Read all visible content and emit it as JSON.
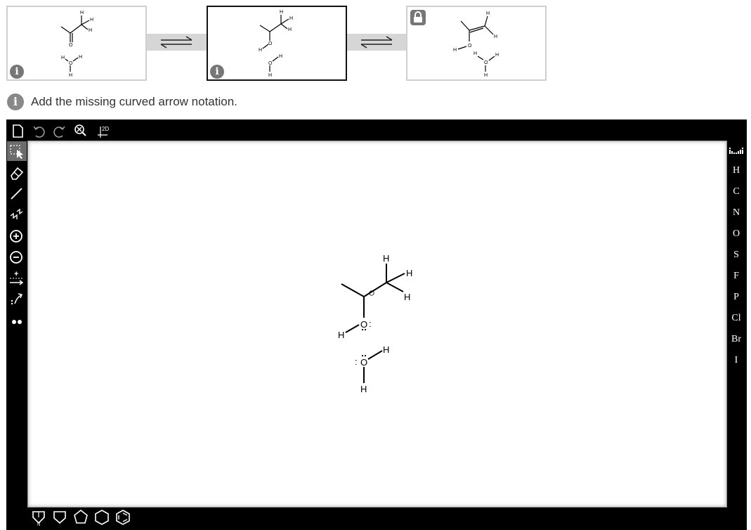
{
  "instruction": {
    "text": "Add the missing curved arrow notation.",
    "icon": "info-icon"
  },
  "steps": [
    {
      "name": "step-1",
      "icon": "info-icon",
      "state": "normal"
    },
    {
      "name": "step-2",
      "icon": "info-icon",
      "state": "current"
    },
    {
      "name": "step-3",
      "icon": "lock-icon",
      "state": "locked"
    }
  ],
  "equilibrium_icon": "equilibrium-arrows-icon",
  "toolbar_top": [
    "new-document-icon",
    "undo-icon",
    "redo-icon",
    "clear-zoom-icon",
    "clean-2d-icon"
  ],
  "toolbar_top_labels": {
    "clean2d": "2D"
  },
  "toolbar_left": [
    {
      "icon": "select-icon",
      "active": true
    },
    {
      "icon": "eraser-icon"
    },
    {
      "icon": "single-bond-icon"
    },
    {
      "icon": "chain-icon"
    },
    {
      "icon": "positive-charge-icon"
    },
    {
      "icon": "negative-charge-icon"
    },
    {
      "icon": "reaction-arrow-icon"
    },
    {
      "icon": "curved-arrow-icon"
    },
    {
      "icon": "lone-pair-icon"
    }
  ],
  "toolbar_left_labels": {
    "charge_plus": "+"
  },
  "elements": [
    "H",
    "C",
    "N",
    "O",
    "S",
    "F",
    "P",
    "Cl",
    "Br",
    "I"
  ],
  "periodic_table_icon": "periodic-table-icon",
  "toolbar_bottom": [
    "cyclopropane-icon",
    "cyclobutane-icon",
    "cyclopentane-icon",
    "cyclohexane-icon",
    "benzene-icon"
  ],
  "ring_label": "N",
  "atoms": {
    "H": "H",
    "O": "O",
    "lone_pair": ":",
    "charge_plus": "+",
    "charge_circle": "⊕"
  }
}
